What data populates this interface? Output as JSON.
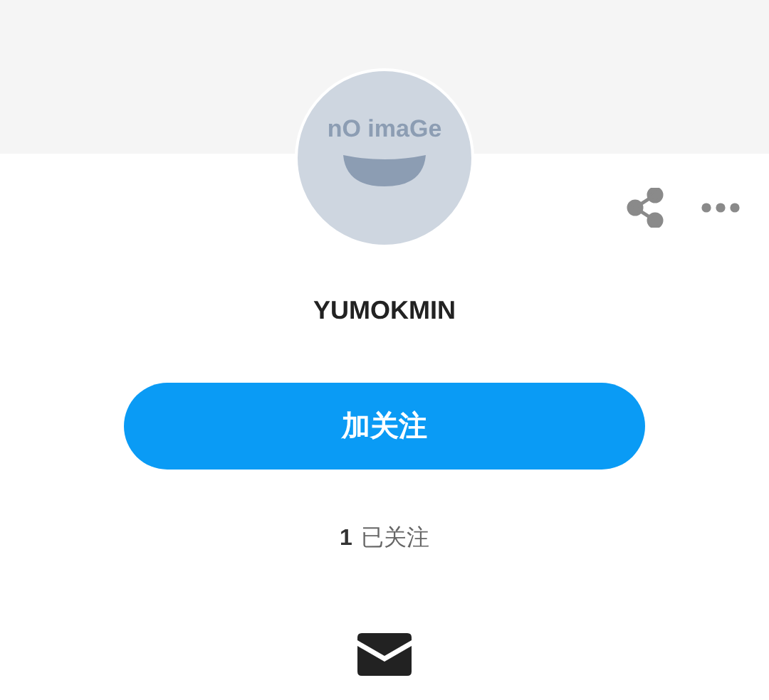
{
  "avatar": {
    "label": "nO imaGe"
  },
  "profile": {
    "name": "YUMOKMIN"
  },
  "follow_button": {
    "label": "加关注"
  },
  "following": {
    "count": "1",
    "label": "已关注"
  }
}
